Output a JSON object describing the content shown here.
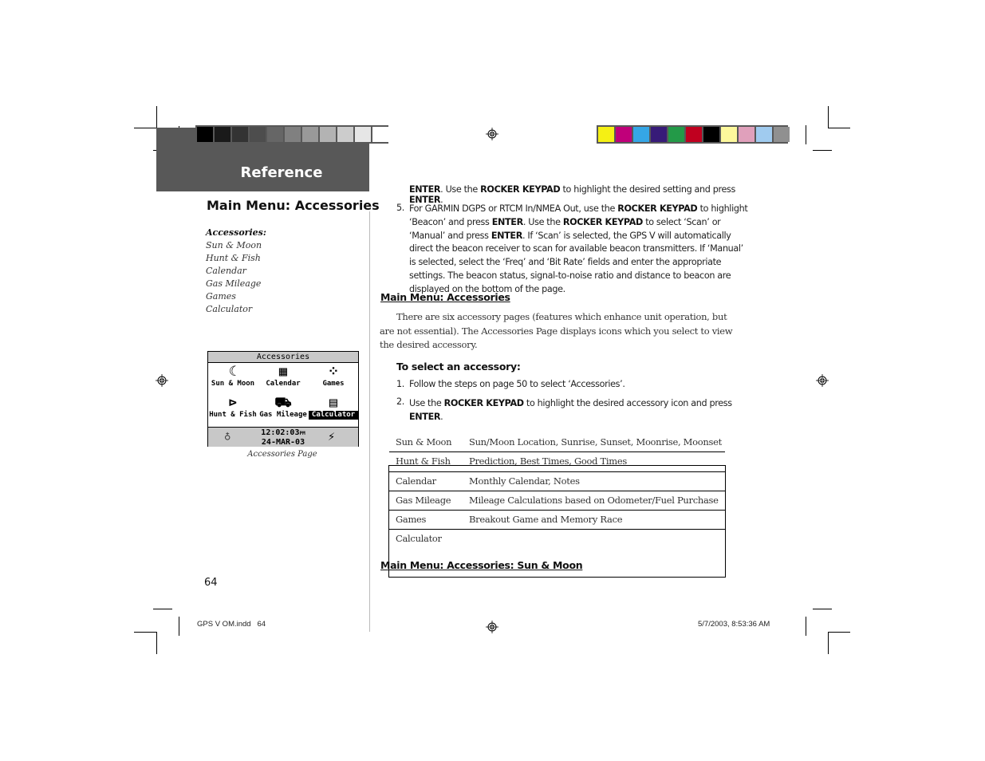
{
  "header": {
    "section_title": "Reference",
    "gray_swatches": [
      "#000000",
      "#1a1a1a",
      "#333333",
      "#4d4d4d",
      "#666666",
      "#808080",
      "#999999",
      "#b3b3b3",
      "#cccccc",
      "#e6e6e6",
      "#ffffff"
    ],
    "color_swatches": [
      "#f5f014",
      "#c0007a",
      "#35a6e6",
      "#371b78",
      "#239a48",
      "#c0001f",
      "#000000",
      "#fdf89c",
      "#e0a0bb",
      "#a0cbef",
      "#909090"
    ]
  },
  "sidebar": {
    "title": "Main Menu: Accessories",
    "list_heading": "Accessories:",
    "list_items": [
      "Sun & Moon",
      "Hunt & Fish",
      "Calendar",
      "Gas Mileage",
      "Games",
      "Calculator"
    ],
    "screen": {
      "title": "Accessories",
      "icons": [
        {
          "label": "Sun & Moon",
          "icon": "sun-moon-icon",
          "glyph": "☾",
          "selected": false
        },
        {
          "label": "Calendar",
          "icon": "calendar-icon",
          "glyph": "▦",
          "selected": false
        },
        {
          "label": "Games",
          "icon": "games-icon",
          "glyph": "⁘",
          "selected": false
        },
        {
          "label": "Hunt & Fish",
          "icon": "fish-icon",
          "glyph": "⊳",
          "selected": false
        },
        {
          "label": "Gas Mileage",
          "icon": "car-icon",
          "glyph": "⛟",
          "selected": false
        },
        {
          "label": "Calculator",
          "icon": "calculator-icon",
          "glyph": "▤",
          "selected": true
        }
      ],
      "time": "12:02:03",
      "time_suffix": "PM",
      "date": "24-MAR-03",
      "bulb_glyph": "♁",
      "plug_glyph": "⚡"
    },
    "caption": "Accessories Page",
    "page_number": "64"
  },
  "main": {
    "step4_cont": [
      {
        "t": "ENTER",
        "b": true
      },
      {
        "t": ". Use the ",
        "b": false
      },
      {
        "t": "ROCKER KEYPAD",
        "b": true
      },
      {
        "t": " to highlight the desired setting and press ",
        "b": false
      },
      {
        "t": "ENTER",
        "b": true
      },
      {
        "t": ".",
        "b": false
      }
    ],
    "step5_num": "5.",
    "step5": [
      {
        "t": "For GARMIN DGPS or RTCM In/NMEA Out, use the ",
        "b": false
      },
      {
        "t": "ROCKER KEYPAD",
        "b": true
      },
      {
        "t": " to highlight ‘Beacon’ and press ",
        "b": false
      },
      {
        "t": "ENTER",
        "b": true
      },
      {
        "t": ". Use the ",
        "b": false
      },
      {
        "t": "ROCKER KEYPAD",
        "b": true
      },
      {
        "t": " to select ‘Scan’ or ‘Manual’ and press ",
        "b": false
      },
      {
        "t": "ENTER",
        "b": true
      },
      {
        "t": ". If ‘Scan’ is selected, the GPS V will automatically direct the beacon receiver to scan for available beacon transmitters. If ‘Manual’ is selected, select the ‘Freq’ and ‘Bit Rate’ fields and enter the appropriate settings. The beacon status, signal-to-noise ratio and distance to beacon are displayed on the bottom of the page.",
        "b": false
      }
    ],
    "accessories_heading": "Main Menu: Accessories",
    "accessories_para": "There are six accessory pages (features which enhance unit operation, but are not essential).  The Accessories Page displays icons which you select to view the desired accessory.",
    "select_heading": "To select an accessory:",
    "step1_num": "1.",
    "step1": "Follow the steps on page 50 to select ‘Accessories’.",
    "step2_num": "2.",
    "step2": [
      {
        "t": "Use the ",
        "b": false
      },
      {
        "t": "ROCKER KEYPAD",
        "b": true
      },
      {
        "t": " to highlight the desired accessory icon and press ",
        "b": false
      },
      {
        "t": "ENTER",
        "b": true
      },
      {
        "t": ".",
        "b": false
      }
    ],
    "table": [
      {
        "name": "Sun & Moon",
        "desc": "Sun/Moon Location, Sunrise, Sunset, Moonrise, Moonset"
      },
      {
        "name": "Hunt & Fish",
        "desc": "Prediction, Best Times, Good Times"
      },
      {
        "name": "Calendar",
        "desc": "Monthly Calendar, Notes"
      },
      {
        "name": "Gas Mileage",
        "desc": "Mileage Calculations based on Odometer/Fuel Purchase"
      },
      {
        "name": "Games",
        "desc": "Breakout Game and Memory Race"
      },
      {
        "name": "Calculator",
        "desc": ""
      }
    ],
    "sun_moon_heading": "Main Menu: Accessories: Sun & Moon"
  },
  "footer": {
    "file": "GPS V OM.indd   64",
    "timestamp": "5/7/2003, 8:53:36 AM"
  }
}
